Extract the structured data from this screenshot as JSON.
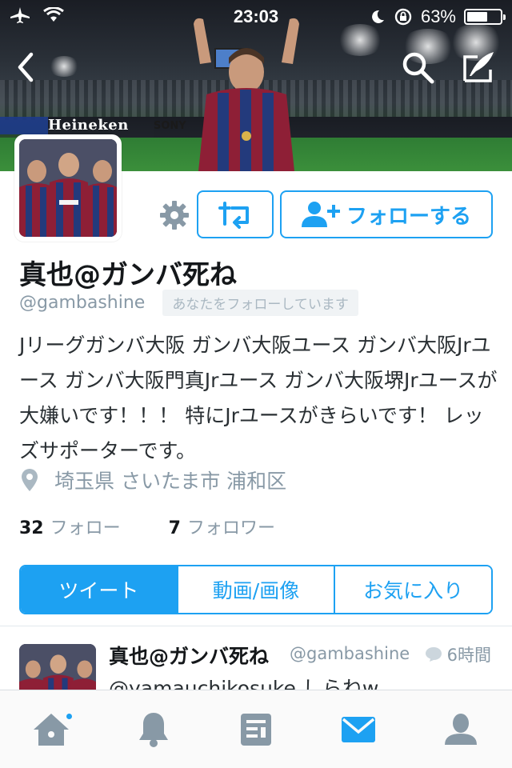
{
  "status_bar": {
    "time": "23:03",
    "battery_text": "63%",
    "battery_level": 0.63
  },
  "banner": {
    "board_text": "Heineken",
    "board_text2": "SONY"
  },
  "profile": {
    "name": "真也@ガンバ死ね",
    "handle": "@gambashine",
    "follows_you": "あなたをフォローしています",
    "bio": "Jリーグガンバ大阪 ガンバ大阪ユース ガンバ大阪Jrユース ガンバ大阪門真Jrユース ガンバ大阪堺Jrユースが大嫌いです！！！ 特にJrユースがきらいです！ レッズサポーターです。",
    "location": "埼玉県 さいたま市 浦和区",
    "following_count": "32",
    "following_label": "フォロー",
    "followers_count": "7",
    "followers_label": "フォロワー"
  },
  "actions": {
    "follow_label": "フォローする"
  },
  "tabs": [
    {
      "label": "ツイート",
      "active": true
    },
    {
      "label": "動画/画像",
      "active": false
    },
    {
      "label": "お気に入り",
      "active": false
    }
  ],
  "tweet": {
    "name": "真也@ガンバ死ね",
    "handle": "@gambashine",
    "time": "6時間",
    "text": "@yamauchikosuke しらねw"
  },
  "colors": {
    "accent": "#1da1f2",
    "muted": "#8899a6",
    "icon_gray": "#8899a6"
  },
  "icons": {
    "tabbar": [
      "home-icon",
      "notifications-icon",
      "moments-icon",
      "messages-icon",
      "profile-icon"
    ],
    "active_tab": "messages-icon"
  }
}
